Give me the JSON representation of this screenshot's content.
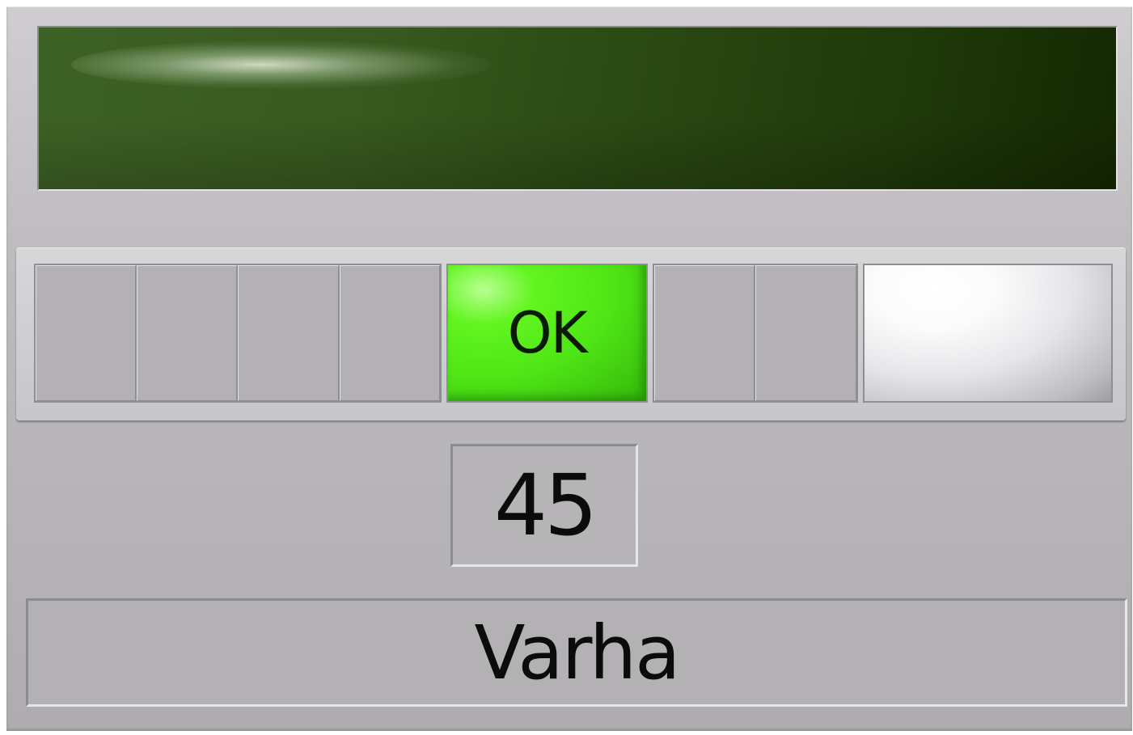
{
  "display": {
    "lcd_color": "#2b4913"
  },
  "status_bar": {
    "segments": [
      {
        "type": "off"
      },
      {
        "type": "off"
      },
      {
        "type": "off"
      },
      {
        "type": "off"
      },
      {
        "type": "active",
        "label": "OK",
        "color": "#4fe616"
      },
      {
        "type": "off"
      },
      {
        "type": "off"
      },
      {
        "type": "lamp",
        "color": "#ffffff"
      }
    ],
    "active_label": "OK"
  },
  "value": {
    "number": "45"
  },
  "name": {
    "label": "Varha"
  }
}
